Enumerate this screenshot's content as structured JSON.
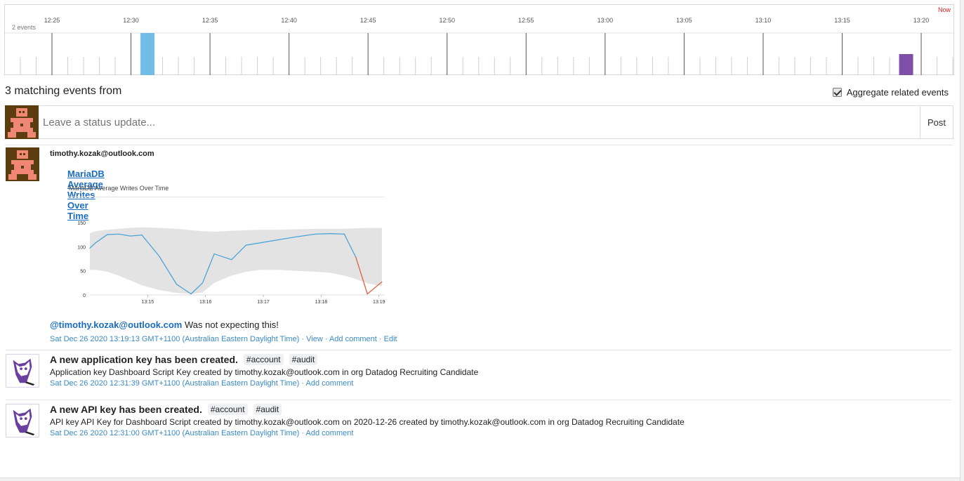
{
  "timeline": {
    "count_label": "2 events",
    "now_label": "Now",
    "ticks": [
      "12:25",
      "12:30",
      "12:35",
      "12:40",
      "12:45",
      "12:50",
      "12:55",
      "13:00",
      "13:05",
      "13:10",
      "13:15",
      "13:20"
    ],
    "bars": [
      {
        "time": "12:31",
        "color": "#72bde8",
        "level": 1.0
      },
      {
        "time": "13:19",
        "color": "#7f4fa8",
        "level": 0.5
      }
    ]
  },
  "summary": "3 matching events from",
  "aggregate_label": "Aggregate related events",
  "status": {
    "placeholder": "Leave a status update...",
    "post_label": "Post"
  },
  "events": [
    {
      "author": "timothy.kozak@outlook.com",
      "snapshot_title": "MariaDB Average Writes Over Time",
      "snapshot_subtitle": "MariaDB Average Writes Over Time",
      "mention": "@timothy.kozak@outlook.com",
      "comment": "Was not expecting this!",
      "timestamp": "Sat Dec 26 2020 13:19:13 GMT+1100 (Australian Eastern Daylight Time)",
      "actions": [
        "View",
        "Add comment",
        "Edit"
      ]
    },
    {
      "title": "A new application key has been created.",
      "tags": [
        "#account",
        "#audit"
      ],
      "text": "Application key Dashboard Script Key created by timothy.kozak@outlook.com in org Datadog Recruiting Candidate",
      "timestamp": "Sat Dec 26 2020 12:31:39 GMT+1100 (Australian Eastern Daylight Time)",
      "actions": [
        "Add comment"
      ]
    },
    {
      "title": "A new API key has been created.",
      "tags": [
        "#account",
        "#audit"
      ],
      "text": "API key API Key for Dashboard Script created by timothy.kozak@outlook.com on 2020-12-26 created by timothy.kozak@outlook.com in org Datadog Recruiting Candidate",
      "timestamp": "Sat Dec 26 2020 12:31:00 GMT+1100 (Australian Eastern Daylight Time)",
      "actions": [
        "Add comment"
      ]
    }
  ],
  "chart_data": {
    "type": "line",
    "title": "MariaDB Average Writes Over Time",
    "y_ticks": [
      0,
      50,
      100,
      150
    ],
    "ylim": [
      0,
      160
    ],
    "x_tick_labels": [
      "13:15",
      "13:16",
      "13:17",
      "13:18",
      "13:19"
    ],
    "xlim_minutes": [
      14.0,
      19.1
    ],
    "series": [
      {
        "x": [
          14.0,
          14.1,
          14.3,
          14.5,
          14.7,
          14.9,
          15.2,
          15.5,
          15.75,
          15.95,
          16.15,
          16.45,
          16.7,
          16.95,
          17.25,
          17.55,
          17.9,
          18.15,
          18.4,
          18.6,
          18.8,
          19.05
        ],
        "y": [
          97,
          108,
          125,
          126,
          122,
          124,
          80,
          22,
          2,
          25,
          85,
          73,
          103,
          108,
          114,
          120,
          126,
          127,
          126,
          78,
          2,
          27
        ],
        "color": "#4aa3d8",
        "anomaly_color": "#e0603c"
      }
    ],
    "band_upper": [
      128,
      132,
      135,
      137,
      139,
      140,
      139,
      137,
      134,
      132,
      131,
      133,
      134,
      135,
      135,
      136,
      137,
      137,
      137,
      138,
      139,
      139
    ],
    "band_lower": [
      52,
      52,
      48,
      40,
      30,
      20,
      10,
      4,
      2,
      5,
      25,
      40,
      48,
      52,
      52,
      50,
      48,
      46,
      40,
      33,
      24,
      18
    ]
  }
}
